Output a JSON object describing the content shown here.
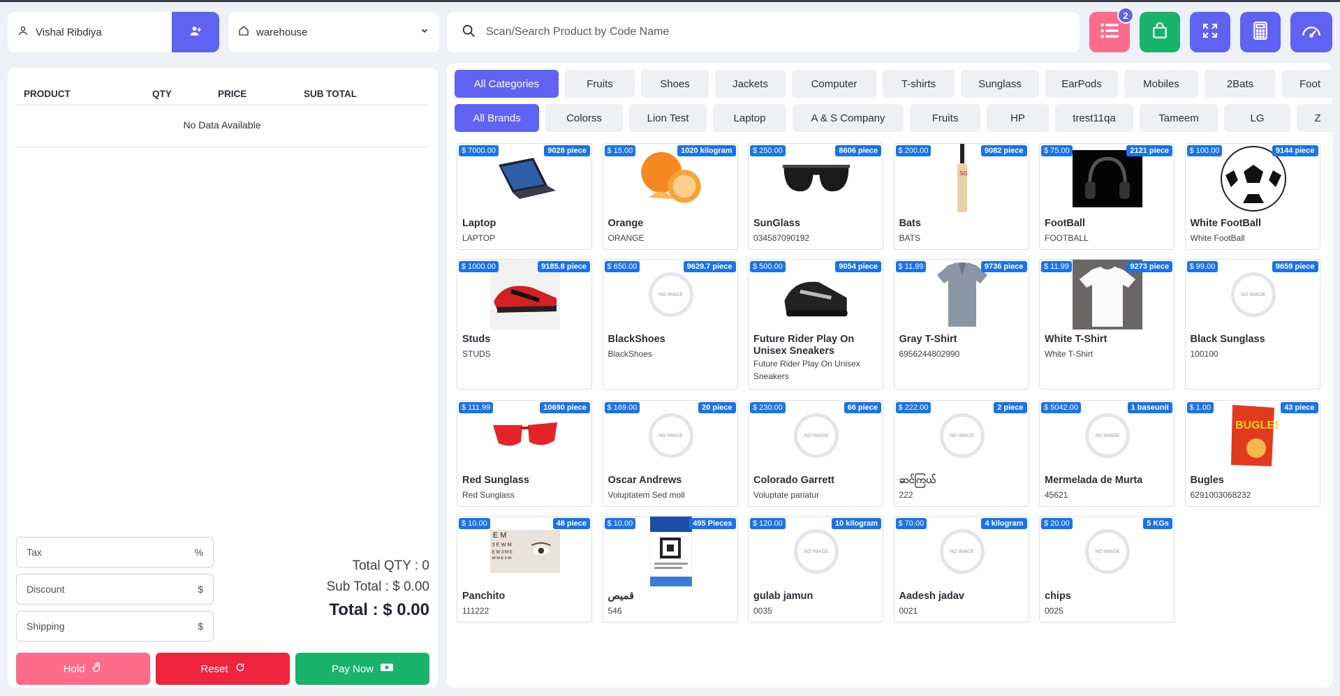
{
  "customer": {
    "name": "Vishal Ribdiya"
  },
  "warehouse": {
    "selected": "warehouse"
  },
  "search": {
    "placeholder": "Scan/Search Product by Code Name"
  },
  "toolbar": {
    "list_badge": "2"
  },
  "cart": {
    "headers": [
      "PRODUCT",
      "QTY",
      "PRICE",
      "SUB TOTAL"
    ],
    "empty_text": "No Data Available",
    "tax_label": "Tax",
    "tax_unit": "%",
    "discount_label": "Discount",
    "discount_unit": "$",
    "shipping_label": "Shipping",
    "shipping_unit": "$",
    "total_qty": "Total QTY : 0",
    "sub_total": "Sub Total : $ 0.00",
    "total": "Total : $ 0.00",
    "hold": "Hold",
    "reset": "Reset",
    "pay": "Pay Now"
  },
  "categories": [
    "All Categories",
    "Fruits",
    "Shoes",
    "Jackets",
    "Computer",
    "T-shirts",
    "Sunglass",
    "EarPods",
    "Mobiles",
    "2Bats",
    "Foot"
  ],
  "brands": [
    "All Brands",
    "Colorss",
    "Lion Test",
    "Laptop",
    "A & S Company",
    "Fruits",
    "HP",
    "trest11qa",
    "Tameem",
    "LG",
    "Z"
  ],
  "products": [
    {
      "name": "Laptop",
      "code": "LAPTOP",
      "price": "$ 7000.00",
      "qty": "9028 piece",
      "icon": "laptop-image"
    },
    {
      "name": "Orange",
      "code": "ORANGE",
      "price": "$ 15.00",
      "qty": "1020 kilogram",
      "icon": "orange-image"
    },
    {
      "name": "SunGlass",
      "code": "034587090192",
      "price": "$ 250.00",
      "qty": "8606 piece",
      "icon": "sunglass-image"
    },
    {
      "name": "Bats",
      "code": "BATS",
      "price": "$ 200.00",
      "qty": "9082 piece",
      "icon": "bat-image"
    },
    {
      "name": "FootBall",
      "code": "FOOTBALL",
      "price": "$ 75.00",
      "qty": "2121 piece",
      "icon": "headphones-image"
    },
    {
      "name": "White FootBall",
      "code": "White FootBall",
      "price": "$ 100.00",
      "qty": "9144 piece",
      "icon": "football-image"
    },
    {
      "name": "Studs",
      "code": "STUDS",
      "price": "$ 1000.00",
      "qty": "9185.8 piece",
      "icon": "studs-image"
    },
    {
      "name": "BlackShoes",
      "code": "BlackShoes",
      "price": "$ 650.00",
      "qty": "9629.7 piece",
      "icon": "no-image"
    },
    {
      "name": "Future Rider Play On Unisex Sneakers",
      "code": "Future Rider Play On Unisex Sneakers",
      "price": "$ 500.00",
      "qty": "9054 piece",
      "icon": "sneaker-image"
    },
    {
      "name": "Gray T-Shirt",
      "code": "6956244802990",
      "price": "$ 11.99",
      "qty": "9736 piece",
      "icon": "gray-shirt-image"
    },
    {
      "name": "White T-Shirt",
      "code": "White T-Shirt",
      "price": "$ 11.99",
      "qty": "9273 piece",
      "icon": "white-shirt-image"
    },
    {
      "name": "Black Sunglass",
      "code": "100100",
      "price": "$ 99.00",
      "qty": "9659 piece",
      "icon": "no-image"
    },
    {
      "name": "Red Sunglass",
      "code": "Red Sunglass",
      "price": "$ 111.99",
      "qty": "10690 piece",
      "icon": "red-sunglass-image"
    },
    {
      "name": "Oscar Andrews",
      "code": "Voluptatem Sed moll",
      "price": "$ 169.00",
      "qty": "20 piece",
      "icon": "no-image"
    },
    {
      "name": "Colorado Garrett",
      "code": "Voluptate pariatur",
      "price": "$ 230.00",
      "qty": "66 piece",
      "icon": "no-image"
    },
    {
      "name": "ဆင်ကြယ်",
      "code": "222",
      "price": "$ 222.00",
      "qty": "2 piece",
      "icon": "no-image"
    },
    {
      "name": "Mermelada de Murta",
      "code": "45621",
      "price": "$ 5042.00",
      "qty": "1 baseunit",
      "icon": "no-image"
    },
    {
      "name": "Bugles",
      "code": "6291003068232",
      "price": "$ 1.00",
      "qty": "43 piece",
      "icon": "bugles-image"
    },
    {
      "name": "Panchito",
      "code": "111222",
      "price": "$ 10.00",
      "qty": "48 piece",
      "icon": "eye-chart-image"
    },
    {
      "name": "قميص",
      "code": "546",
      "price": "$ 10.00",
      "qty": "495 Pieces",
      "icon": "document-image"
    },
    {
      "name": "gulab jamun",
      "code": "0035",
      "price": "$ 120.00",
      "qty": "10 kilogram",
      "icon": "no-image"
    },
    {
      "name": "Aadesh jadav",
      "code": "0021",
      "price": "$ 70.00",
      "qty": "4 kilogram",
      "icon": "no-image"
    },
    {
      "name": "chips",
      "code": "0025",
      "price": "$ 20.00",
      "qty": "5 KGs",
      "icon": "no-image"
    }
  ],
  "no_image_text": "NO IMAGE",
  "colors": {
    "primary": "#5f63f2",
    "pink": "#ff6b8b",
    "red": "#f0243c",
    "green": "#19b36b",
    "tag": "#1a73e8"
  }
}
